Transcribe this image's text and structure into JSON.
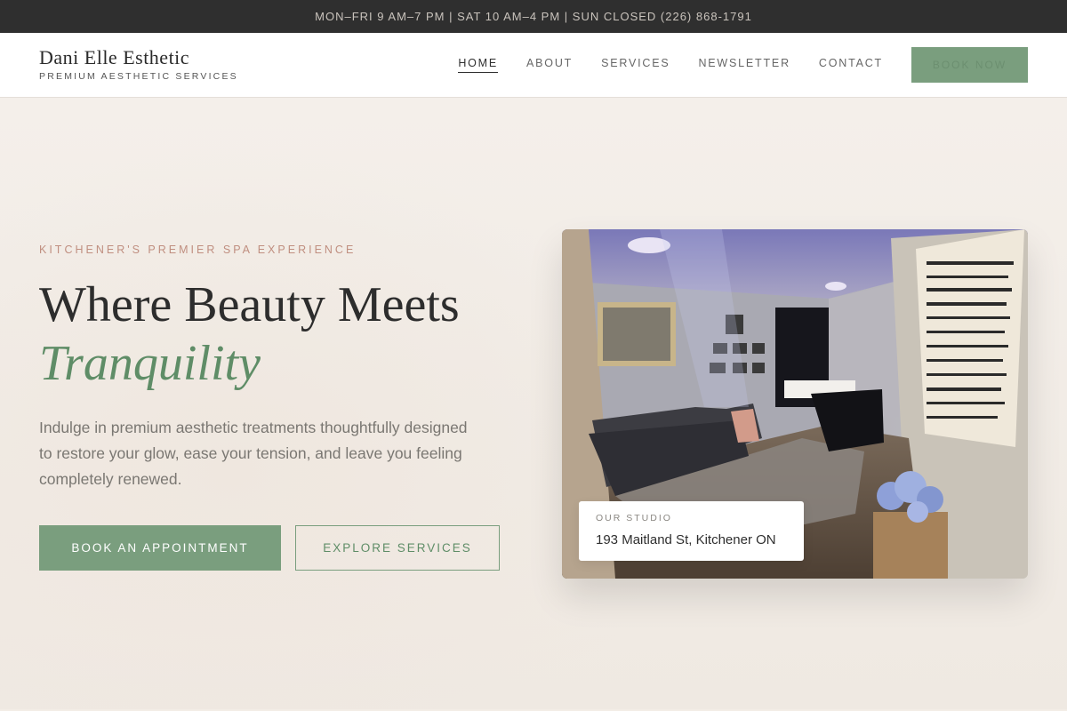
{
  "topbar": {
    "info": "MON–FRI 9 AM–7 PM  |  SAT 10 AM–4 PM  |  SUN CLOSED     (226) 868-1791"
  },
  "brand": {
    "name": "Dani Elle Esthetic",
    "tagline": "PREMIUM AESTHETIC SERVICES"
  },
  "nav": {
    "items": [
      {
        "label": "HOME",
        "active": true
      },
      {
        "label": "ABOUT"
      },
      {
        "label": "SERVICES"
      },
      {
        "label": "NEWSLETTER"
      },
      {
        "label": "CONTACT"
      }
    ],
    "cta": "BOOK NOW"
  },
  "hero": {
    "eyebrow": "KITCHENER'S PREMIER SPA EXPERIENCE",
    "headline": "Where Beauty Meets",
    "headline_accent": "Tranquility",
    "lede": "Indulge in premium aesthetic treatments thoughtfully designed to restore your glow, ease your tension, and leave you feeling completely renewed.",
    "primary_cta": "BOOK AN APPOINTMENT",
    "secondary_cta": "EXPLORE SERVICES"
  },
  "studio": {
    "label": "OUR STUDIO",
    "address": "193 Maitland St, Kitchener ON"
  },
  "colors": {
    "accent": "#7a9e7e",
    "accent_text": "#5f8d67",
    "eyebrow": "#c08f80",
    "topbar": "#2f2f2f"
  }
}
